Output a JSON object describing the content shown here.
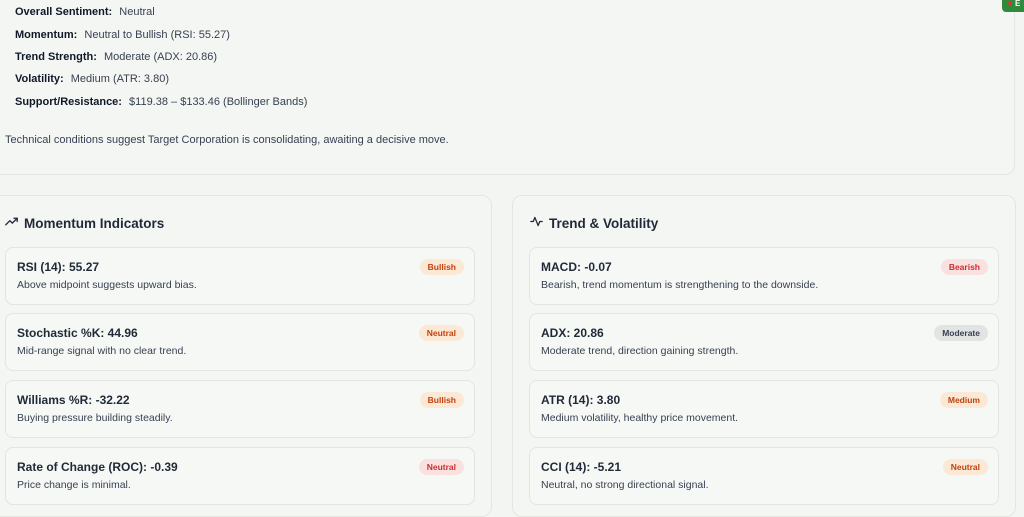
{
  "summary": {
    "overall_sentiment": {
      "label": "Overall Sentiment:",
      "value": "Neutral"
    },
    "momentum": {
      "label": "Momentum:",
      "value": "Neutral to Bullish (RSI: 55.27)"
    },
    "trend_strength": {
      "label": "Trend Strength:",
      "value": "Moderate (ADX: 20.86)"
    },
    "volatility": {
      "label": "Volatility:",
      "value": "Medium (ATR: 3.80)"
    },
    "support_resistance": {
      "label": "Support/Resistance:",
      "value": "$119.38 – $133.46 (Bollinger Bands)"
    },
    "note": "Technical conditions suggest Target Corporation is consolidating, awaiting a decisive move."
  },
  "corner_badge": {
    "letter": "E"
  },
  "momentum_panel": {
    "title": "Momentum Indicators",
    "icon": "trending-up-icon",
    "cards": [
      {
        "title": "RSI (14): 55.27",
        "desc": "Above midpoint suggests upward bias.",
        "badge": "Bullish"
      },
      {
        "title": "Stochastic %K: 44.96",
        "desc": "Mid-range signal with no clear trend.",
        "badge": "Neutral"
      },
      {
        "title": "Williams %R: -32.22",
        "desc": "Buying pressure building steadily.",
        "badge": "Bullish"
      },
      {
        "title": "Rate of Change (ROC): -0.39",
        "desc": "Price change is minimal.",
        "badge": "Neutral"
      }
    ]
  },
  "trend_panel": {
    "title": "Trend & Volatility",
    "icon": "activity-icon",
    "cards": [
      {
        "title": "MACD: -0.07",
        "desc": "Bearish, trend momentum is strengthening to the downside.",
        "badge": "Bearish"
      },
      {
        "title": "ADX: 20.86",
        "desc": "Moderate trend, direction gaining strength.",
        "badge": "Moderate"
      },
      {
        "title": "ATR (14): 3.80",
        "desc": "Medium volatility, healthy price movement.",
        "badge": "Medium"
      },
      {
        "title": "CCI (14): -5.21",
        "desc": "Neutral, no strong directional signal.",
        "badge": "Neutral"
      }
    ]
  }
}
